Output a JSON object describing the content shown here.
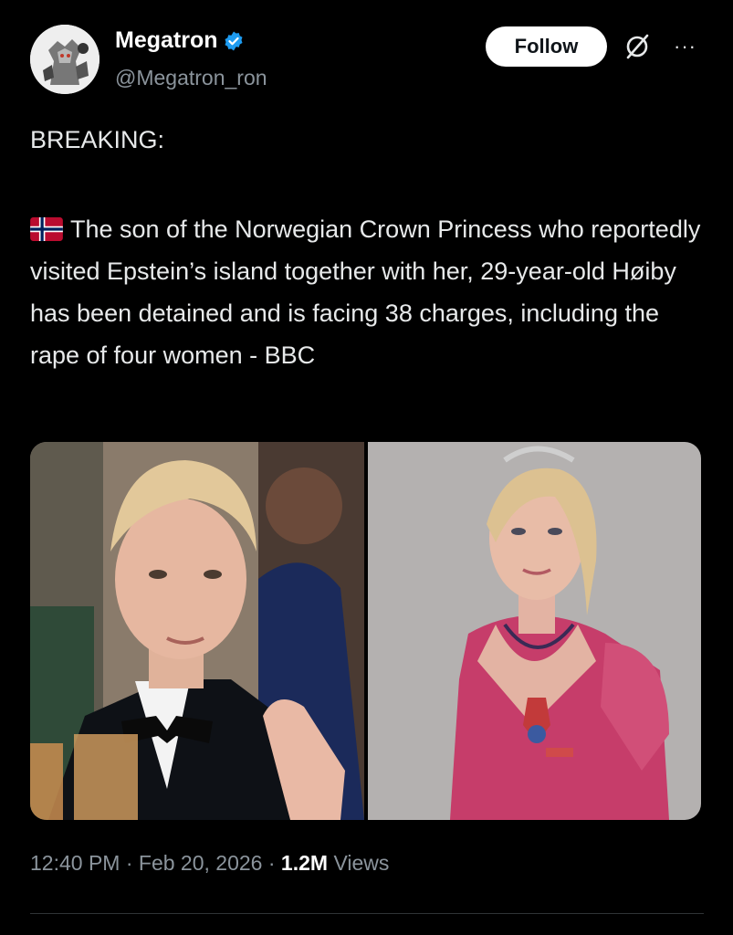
{
  "author": {
    "display_name": "Megatron",
    "handle": "@Megatron_ron",
    "verified": true
  },
  "actions": {
    "follow_label": "Follow",
    "more_label": "···"
  },
  "post": {
    "headline": "BREAKING:",
    "flag_icon": "norway-flag-icon",
    "text": "The son of the Norwegian Crown Princess who reportedly visited Epstein’s island together with her, 29-year-old Høiby has been detained and is facing 38 charges, including the rape of four women - BBC"
  },
  "meta": {
    "time": "12:40 PM",
    "separator": "·",
    "date": "Feb 20, 2026",
    "views_count": "1.2M",
    "views_label": "Views"
  },
  "colors": {
    "background": "#000000",
    "text": "#e7e9ea",
    "secondary": "#8b949c",
    "verified_blue": "#1d9bf0",
    "follow_bg": "#ffffff"
  }
}
